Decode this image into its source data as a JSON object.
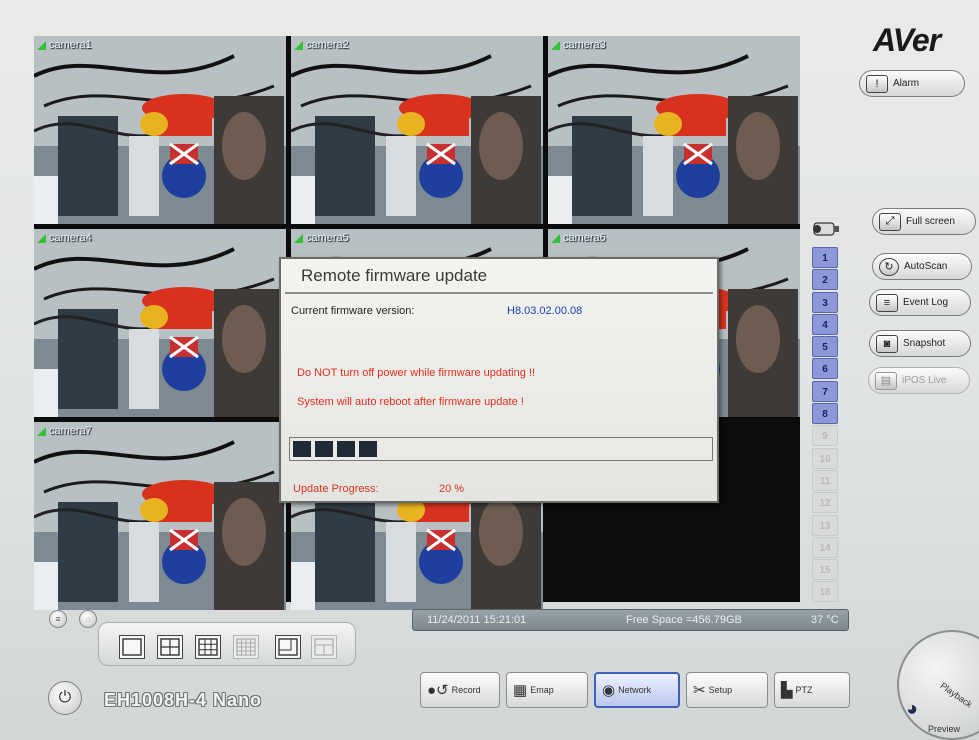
{
  "brand": {
    "logo": "AVer"
  },
  "cameras": [
    {
      "label": "camera1"
    },
    {
      "label": "camera2"
    },
    {
      "label": "camera3"
    },
    {
      "label": "camera4"
    },
    {
      "label": "camera5"
    },
    {
      "label": "camera6"
    },
    {
      "label": "camera7"
    }
  ],
  "dialog": {
    "title": "Remote firmware update",
    "firmware_label": "Current firmware version:",
    "firmware_value": "H8.03.02.00.08",
    "warning_1": "Do NOT turn off power while firmware updating !!",
    "warning_2": "System will auto reboot after firmware update !",
    "progress_label": "Update Progress:",
    "progress_text": "20 %",
    "progress_fraction": 0.2
  },
  "channels": [
    "1",
    "2",
    "3",
    "4",
    "5",
    "6",
    "7",
    "8",
    "9",
    "10",
    "11",
    "12",
    "13",
    "14",
    "15",
    "16"
  ],
  "active_channels": 8,
  "right_buttons": {
    "alarm": "Alarm",
    "full_screen": "Full screen",
    "autoscan": "AutoScan",
    "event_log": "Event Log",
    "snapshot": "Snapshot",
    "ipos_live": "iPOS Live"
  },
  "status": {
    "date": "11/24/2011 15:21:01",
    "free_space": "Free Space =456.79GB",
    "temperature": "37 °C"
  },
  "device": {
    "model": "EH1008H-4 Nano"
  },
  "bottom_buttons": {
    "record": "Record",
    "emap": "Emap",
    "network": "Network",
    "setup": "Setup",
    "ptz": "PTZ"
  },
  "mode_dial": {
    "playback": "Playback",
    "preview": "Preview"
  },
  "colors": {
    "channel_active": "#8c98d8",
    "warning_text": "#e03020",
    "firmware_value": "#1a3fb0"
  }
}
